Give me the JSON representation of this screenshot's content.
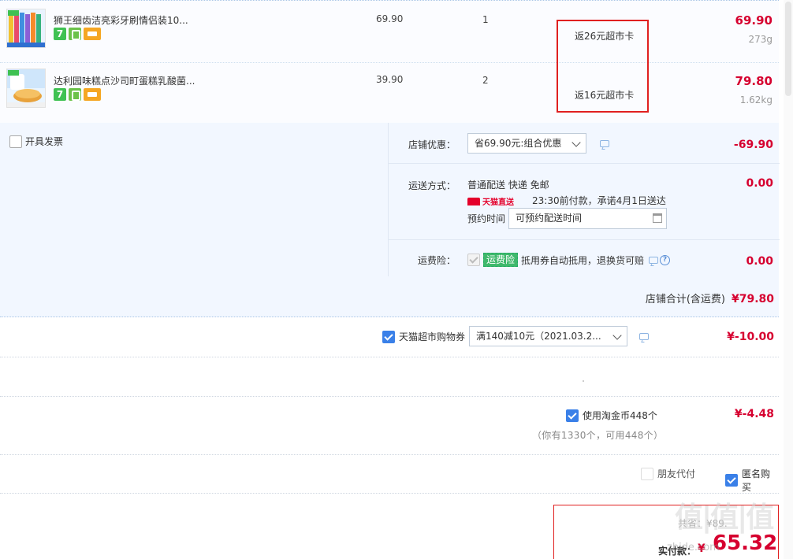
{
  "items": [
    {
      "name": "狮王细齿洁亮彩牙刷情侣装10...",
      "unit_price": "69.90",
      "quantity": "1",
      "rebate": "返26元超市卡",
      "total": "69.90",
      "weight": "273g"
    },
    {
      "name": "达利园味糕点沙司町蛋糕乳酸菌...",
      "unit_price": "39.90",
      "quantity": "2",
      "rebate": "返16元超市卡",
      "total": "79.80",
      "weight": "1.62kg"
    }
  ],
  "order": {
    "invoice_label": "开具发票",
    "shop_discount": {
      "label": "店铺优惠：",
      "selected": "省69.90元:组合优惠",
      "amount": "-69.90"
    },
    "shipping": {
      "label": "运送方式：",
      "method": "普通配送 快递 免邮",
      "badge": "天猫直送",
      "delivery_note": "23:30前付款，承诺4月1日送达",
      "schedule_label": "预约时间",
      "schedule_value": "可预约配送时间",
      "amount": "0.00"
    },
    "insurance": {
      "label": "运费险：",
      "tag": "运费险",
      "text": "抵用券自动抵用，退换货可赔",
      "amount": "0.00"
    },
    "subtotal": {
      "label": "店铺合计(含运费)",
      "amount": "¥79.80"
    }
  },
  "coupon": {
    "label": "天猫超市购物券",
    "selected": "满140减10元（2021.03.2...",
    "amount": "¥-10.00"
  },
  "coins": {
    "label": "使用淘金币448个",
    "note": "（你有1330个，可用448个）",
    "amount": "¥-4.48"
  },
  "payment_options": {
    "friend_pay": "朋友代付",
    "anonymous": "匿名购买"
  },
  "footer": {
    "savings": "共省：¥89.",
    "final_label": "实付款：",
    "currency": "¥",
    "final_amount": "65.32"
  },
  "watermark": {
    "logo": "值|值|值",
    "url": "zhide.com"
  },
  "icons": {
    "same_day": "7",
    "green_badge": "gift-icon",
    "card_badge": "card-icon",
    "message": "message-icon",
    "help": "help-icon",
    "calendar": "calendar-icon"
  },
  "colors": {
    "price_red": "#d6002f",
    "panel_bg": "#f2f7ff",
    "highlight_border": "#e02020",
    "checkbox_blue": "#3a80e8",
    "insurance_green": "#3fb86b"
  }
}
